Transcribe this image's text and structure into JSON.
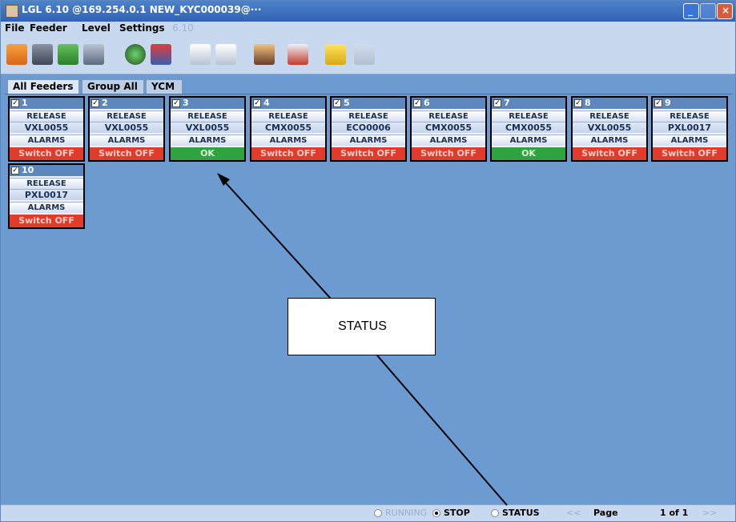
{
  "window": {
    "title": "LGL 6.10  @169.254.0.1 NEW_KYC000039@···"
  },
  "menu": {
    "file": "File",
    "feeder": "Feeder",
    "level": "Level",
    "settings": "Settings",
    "version": "6.10"
  },
  "toolbar": {
    "icons": [
      "folder-open-icon",
      "save-icon",
      "plug-icon",
      "gear-icon",
      "radar-icon",
      "feeder-swap-icon",
      "checklist-icon",
      "dots-grid-icon",
      "users-icon",
      "tools-scissors-icon",
      "key-icon",
      "disabled-tool-icon"
    ]
  },
  "tabs": [
    {
      "label": "All Feeders",
      "active": true
    },
    {
      "label": "Group All",
      "active": false
    },
    {
      "label": "YCM",
      "active": false
    }
  ],
  "feeders": [
    {
      "num": "1",
      "release": "RELEASE",
      "version": "VXL0055",
      "alarms": "ALARMS",
      "status": "Switch OFF",
      "status_color": "#e03b2b"
    },
    {
      "num": "2",
      "release": "RELEASE",
      "version": "VXL0055",
      "alarms": "ALARMS",
      "status": "Switch OFF",
      "status_color": "#e03b2b"
    },
    {
      "num": "3",
      "release": "RELEASE",
      "version": "VXL0055",
      "alarms": "ALARMS",
      "status": "OK",
      "status_color": "#2fa33f"
    },
    {
      "num": "4",
      "release": "RELEASE",
      "version": "CMX0055",
      "alarms": "ALARMS",
      "status": "Switch OFF",
      "status_color": "#e03b2b"
    },
    {
      "num": "5",
      "release": "RELEASE",
      "version": "ECO0006",
      "alarms": "ALARMS",
      "status": "Switch OFF",
      "status_color": "#e03b2b"
    },
    {
      "num": "6",
      "release": "RELEASE",
      "version": "CMX0055",
      "alarms": "ALARMS",
      "status": "Switch OFF",
      "status_color": "#e03b2b"
    },
    {
      "num": "7",
      "release": "RELEASE",
      "version": "CMX0055",
      "alarms": "ALARMS",
      "status": "OK",
      "status_color": "#2fa33f"
    },
    {
      "num": "8",
      "release": "RELEASE",
      "version": "VXL0055",
      "alarms": "ALARMS",
      "status": "Switch OFF",
      "status_color": "#e03b2b"
    },
    {
      "num": "9",
      "release": "RELEASE",
      "version": "PXL0017",
      "alarms": "ALARMS",
      "status": "Switch OFF",
      "status_color": "#e03b2b"
    },
    {
      "num": "10",
      "release": "RELEASE",
      "version": "PXL0017",
      "alarms": "ALARMS",
      "status": "Switch OFF",
      "status_color": "#e03b2b"
    }
  ],
  "statusbar": {
    "running": "RUNNING",
    "stop": "STOP",
    "status": "STATUS",
    "prev": "<<",
    "page_label": "Page",
    "page_value": "1 of 1",
    "next": ">>"
  },
  "annotation": {
    "label": "STATUS"
  },
  "colors": {
    "background": "#6b9bd1",
    "status_off": "#e03b2b",
    "status_ok": "#2fa33f"
  }
}
